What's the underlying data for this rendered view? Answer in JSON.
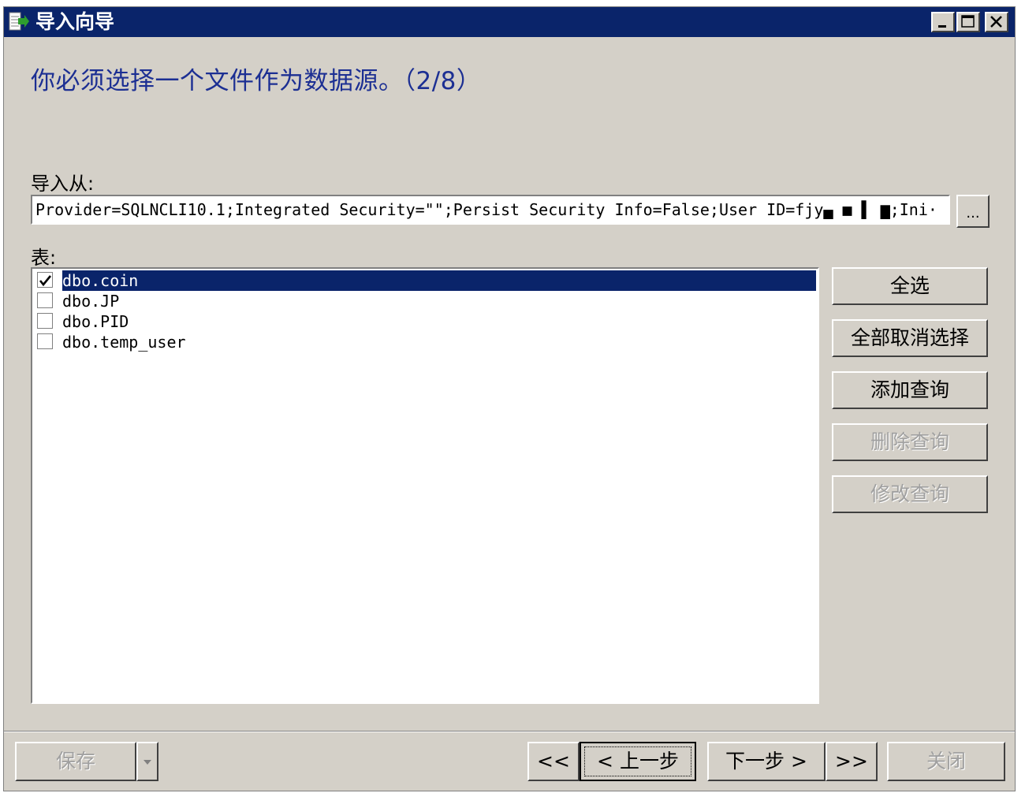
{
  "window": {
    "title": "导入向导",
    "controls": [
      "minimize-icon",
      "maximize-icon",
      "close-icon"
    ],
    "title_bar_color": "#0a246a"
  },
  "heading": "你必须选择一个文件作为数据源。（2/8）",
  "import_from": {
    "label": "导入从:",
    "value": "Provider=SQLNCLI10.1;Integrated Security=\"\";Persist Security Info=False;User ID=fjy▄ ■ ▌ ▆;Ini·",
    "browse_label": "..."
  },
  "tables": {
    "label": "表:",
    "items": [
      {
        "name": "dbo.coin",
        "checked": true,
        "selected": true
      },
      {
        "name": "dbo.JP",
        "checked": false,
        "selected": false
      },
      {
        "name": "dbo.PID",
        "checked": false,
        "selected": false
      },
      {
        "name": "dbo.temp_user",
        "checked": false,
        "selected": false
      }
    ]
  },
  "side_buttons": {
    "select_all": "全选",
    "deselect_all": "全部取消选择",
    "add_query": "添加查询",
    "delete_query": "删除查询",
    "edit_query": "修改查询"
  },
  "footer": {
    "save": "保存",
    "first": "<<",
    "prev": "< 上一步",
    "next": "下一步 >",
    "last": ">>",
    "close": "关闭"
  },
  "colors": {
    "accent": "#0a246a",
    "heading": "#1c2f93",
    "dialog_bg": "#d4d0c8"
  }
}
